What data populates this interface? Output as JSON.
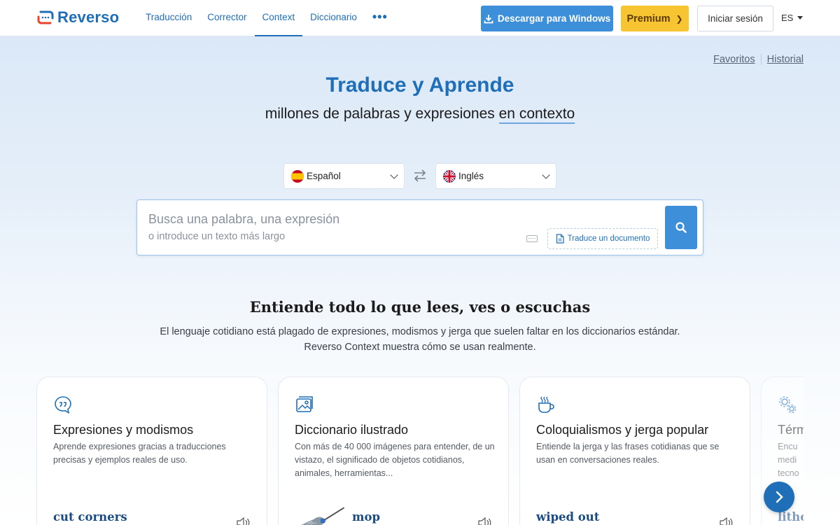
{
  "header": {
    "logo_text": "Reverso",
    "nav": [
      {
        "label": "Traducción",
        "active": false
      },
      {
        "label": "Corrector",
        "active": false
      },
      {
        "label": "Context",
        "active": true
      },
      {
        "label": "Diccionario",
        "active": false
      }
    ],
    "more_label": "•••",
    "download_label": "Descargar para Windows",
    "premium_label": "Premium",
    "login_label": "Iniciar sesión",
    "ui_language": "ES"
  },
  "side_links": {
    "favorites": "Favoritos",
    "history": "Historial"
  },
  "hero": {
    "title": "Traduce y Aprende",
    "subtitle_start": "millones de palabras y expresiones ",
    "subtitle_highlight": "en contexto"
  },
  "languages": {
    "source": "Español",
    "target": "Inglés"
  },
  "search": {
    "placeholder": "Busca una palabra, una expresión",
    "placeholder_secondary": "o introduce un texto más largo",
    "document_button": "Traduce un documento"
  },
  "section": {
    "title": "Entiende todo lo que lees, ves o escuchas",
    "text_line1": "El lenguaje cotidiano está plagado de expresiones, modismos y jerga que suelen faltar en los diccionarios estándar.",
    "text_line2": "Reverso Context muestra cómo se usan realmente."
  },
  "cards": [
    {
      "icon": "speech-bubble-quote-icon",
      "title": "Expresiones y modismos",
      "desc": "Aprende expresiones gracias a traducciones precisas y ejemplos reales de uso.",
      "word": "cut corners"
    },
    {
      "icon": "picture-icon",
      "title": "Diccionario ilustrado",
      "desc": "Con más de 40 000 imágenes para entender, de un vistazo, el significado de objetos cotidianos, animales, herramientas...",
      "word": "mop"
    },
    {
      "icon": "coffee-cup-icon",
      "title": "Coloquialismos y jerga popular",
      "desc": "Entiende la jerga y las frases cotidianas que se usan en conversaciones reales.",
      "word": "wiped out"
    },
    {
      "icon": "gears-icon",
      "title": "Térm",
      "desc_lines": [
        "Encu",
        "medi",
        "tecno"
      ],
      "word": "litho"
    }
  ],
  "colors": {
    "brand_blue": "#1f6fb8",
    "button_blue": "#3d8fd9",
    "premium_yellow": "#f7c531"
  }
}
